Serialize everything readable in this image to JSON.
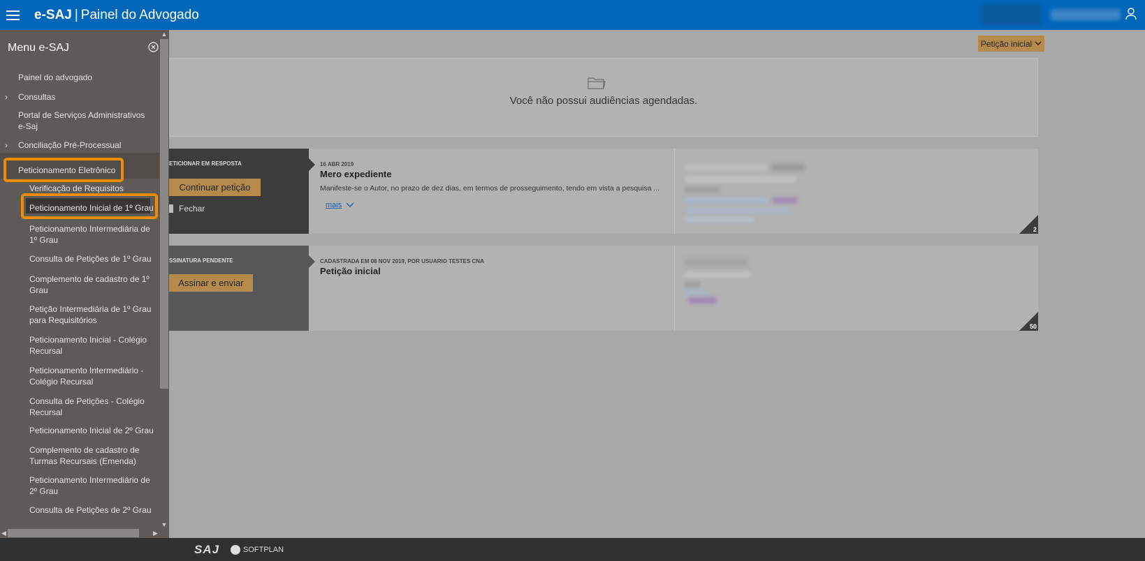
{
  "header": {
    "brand": "e-SAJ",
    "separator": "|",
    "subtitle": "Painel do Advogado",
    "color": "#0066b8"
  },
  "main": {
    "peticao_button": "Petição inicial",
    "audiencias_message": "Você não possui audiências agendadas.",
    "cards": [
      {
        "status_label": "ETICIONAR EM RESPOSTA",
        "action_label": "Continuar petição",
        "close_label": "Fechar",
        "date": "16 ABR 2019",
        "title": "Mero expediente",
        "description": "Manifeste-se o Autor, no prazo de dez dias, em termos de prosseguimento, tendo em vista a pesquisa ...",
        "more_label": "mais",
        "count": "2"
      },
      {
        "status_label": "SSINATURA PENDENTE",
        "action_label": "Assinar e enviar",
        "date": "CADASTRADA EM 08 NOV 2019, POR USUARIO TESTES CNA",
        "title": "Petição inicial",
        "count": "50"
      }
    ]
  },
  "sidebar": {
    "title": "Menu e-SAJ",
    "items": [
      {
        "label": "Painel do advogado",
        "level": 1
      },
      {
        "label": "Consultas",
        "level": 1,
        "chevron": "›"
      },
      {
        "label": "Portal de Serviços Administrativos e-Saj",
        "level": 1
      },
      {
        "label": "Conciliação Pré-Processual",
        "level": 1,
        "chevron": "›"
      },
      {
        "label": "Peticionamento Eletrônico",
        "level": 1,
        "highlight": true
      },
      {
        "label": "Verificação de Requisitos",
        "level": 2
      },
      {
        "label": "Peticionamento Inicial de 1º Grau",
        "level": 2,
        "highlight": true
      },
      {
        "label": "Peticionamento Intermediária de 1º Grau",
        "level": 2
      },
      {
        "label": "Consulta de Petições de 1º Grau",
        "level": 2
      },
      {
        "label": "Complemento de cadastro de 1º Grau",
        "level": 2
      },
      {
        "label": "Petição Intermediária de 1º Grau para Requisitórios",
        "level": 2
      },
      {
        "label": "Peticionamento Inicial - Colégio Recursal",
        "level": 2
      },
      {
        "label": "Peticionamento Intermediário - Colégio Recursal",
        "level": 2
      },
      {
        "label": "Consulta de Petições - Colégio Recursal",
        "level": 2
      },
      {
        "label": "Peticionamento Inicial de 2º Grau",
        "level": 2
      },
      {
        "label": "Complemento de cadastro de Turmas Recursais (Emenda)",
        "level": 2
      },
      {
        "label": "Peticionamento Intermediário de 2º Grau",
        "level": 2
      },
      {
        "label": "Consulta de Petições de 2º Grau",
        "level": 2
      }
    ],
    "highlight_color": "#f08c00"
  },
  "footer": {
    "logo_saj": "SAJ",
    "logo_softplan": "SOFTPLAN"
  },
  "icons": {
    "menu": "hamburger-icon",
    "user": "user-icon",
    "close": "close-circle-icon",
    "folder": "folder-icon",
    "chevron": "chevron-down-icon"
  }
}
